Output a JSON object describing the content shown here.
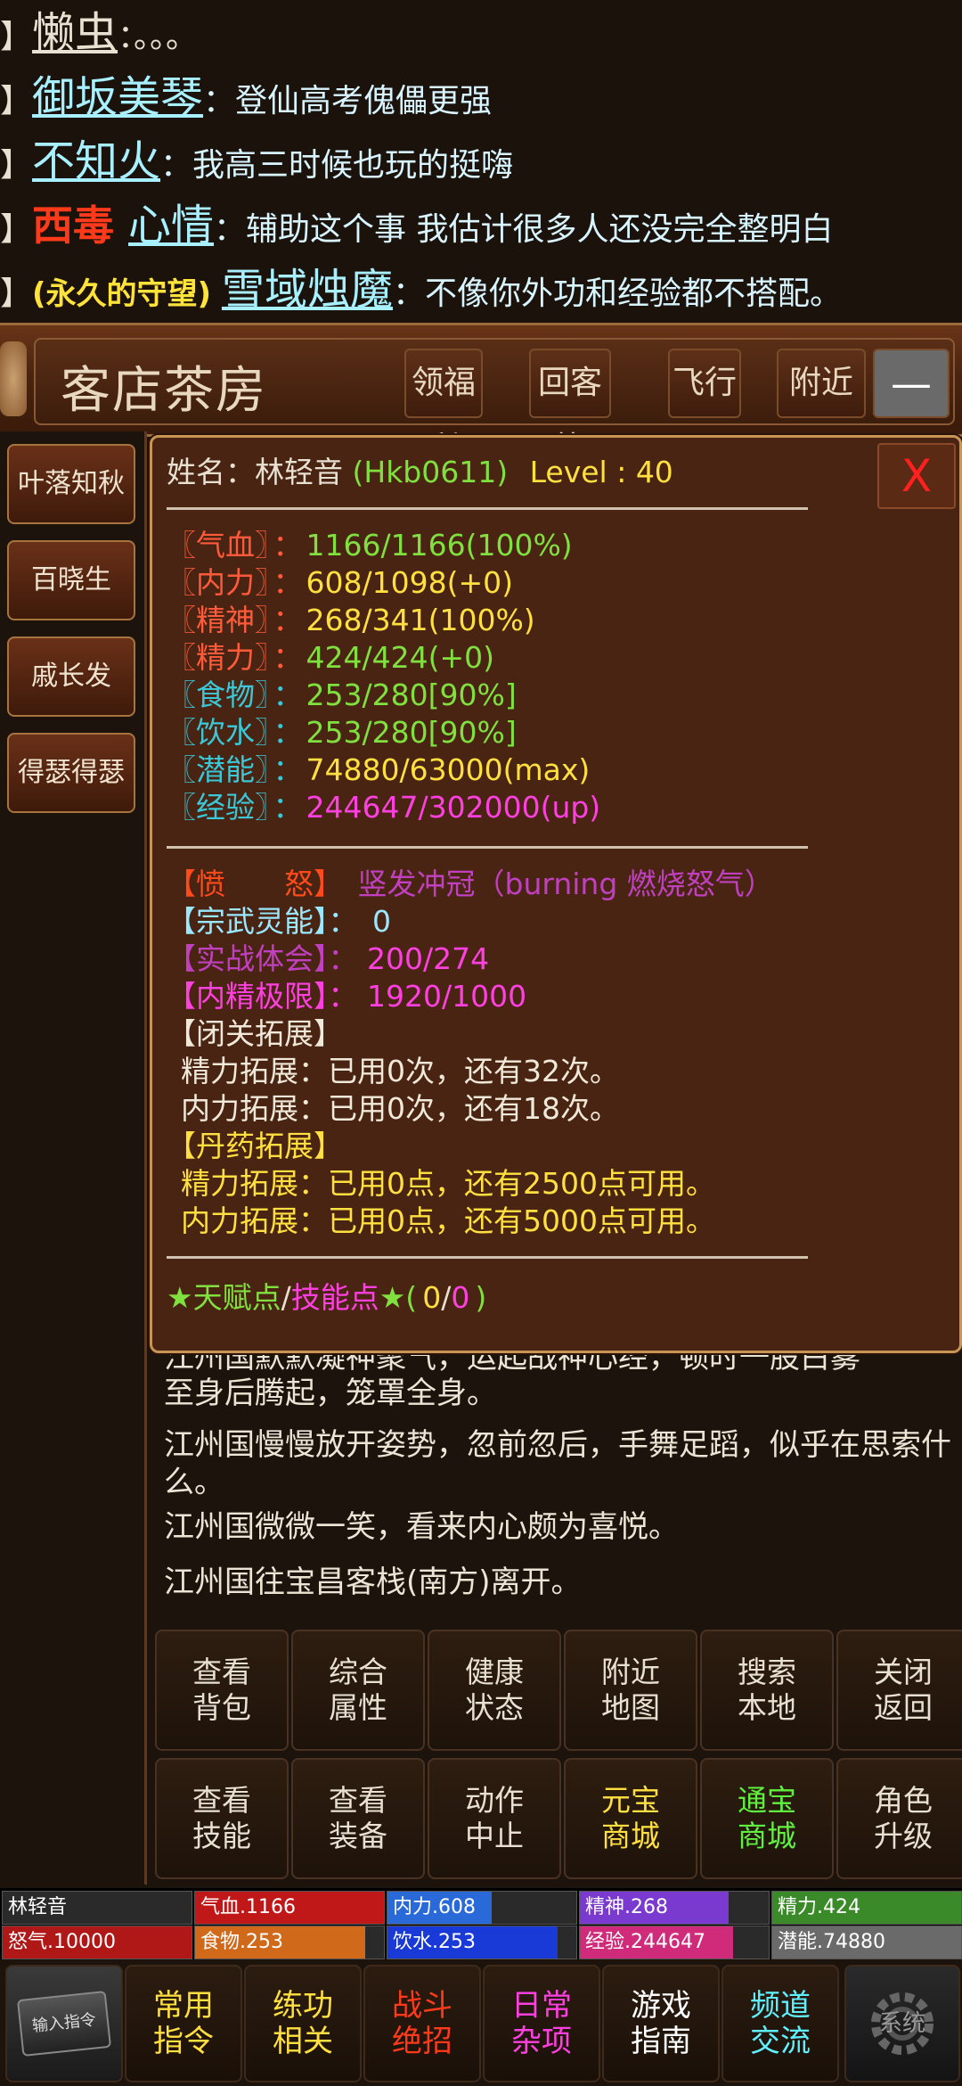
{
  "chat": [
    {
      "prefix": "】",
      "tag": "",
      "name": "懒虫",
      "message": "。。。",
      "name_color": "#e8e0d0"
    },
    {
      "prefix": "】",
      "tag": "",
      "name": "御坂美琴",
      "message": "登仙高考傀儡更强",
      "name_color": "#a8f0ff"
    },
    {
      "prefix": "】",
      "tag": "",
      "name": "不知火",
      "message": "我高三时候也玩的挺嗨",
      "name_color": "#a8f0ff"
    },
    {
      "prefix": "】",
      "tag": "西毒",
      "name": "心情",
      "message": "辅助这个事 我估计很多人还没完全整明白",
      "name_color": "#a8f0ff",
      "tag_color": "#ff3a1a"
    },
    {
      "prefix": "】",
      "tag": "(永久的守望)",
      "name": "雪域烛魔",
      "message": "不像你外功和经验都不搭配。",
      "name_color": "#a8f0ff",
      "tag_color": "#ffe23a"
    }
  ],
  "location": {
    "title": "客店茶房",
    "buttons": [
      "领福利",
      "回客栈",
      "飞行",
      "附近"
    ],
    "collapse": "—"
  },
  "npcs": [
    "叶落知秋",
    "百晓生",
    "戚长发",
    "得瑟得瑟"
  ],
  "character": {
    "name_label": "姓名：",
    "name": "林轻音",
    "id": "(Hkb0611)",
    "level": "Level : 40",
    "close": "X",
    "stats": [
      {
        "label": "〖气血〗",
        "value": "1166/1166(100%)",
        "label_color": "#ff5a3a",
        "value_color": "#80e040"
      },
      {
        "label": "〖内力〗",
        "value": "608/1098(+0)",
        "label_color": "#ff5a3a",
        "value_color": "#ffe040"
      },
      {
        "label": "〖精神〗",
        "value": "268/341(100%)",
        "label_color": "#ff5a3a",
        "value_color": "#ffe040"
      },
      {
        "label": "〖精力〗",
        "value": "424/424(+0)",
        "label_color": "#ff5a3a",
        "value_color": "#80e040"
      },
      {
        "label": "〖食物〗",
        "value": "253/280[90%]",
        "label_color": "#3ac8d8",
        "value_color": "#80e040"
      },
      {
        "label": "〖饮水〗",
        "value": "253/280[90%]",
        "label_color": "#3ac8d8",
        "value_color": "#80e040"
      },
      {
        "label": "〖潜能〗",
        "value": "74880/63000(max)",
        "label_color": "#3ac8d8",
        "value_color": "#ffe040"
      },
      {
        "label": "〖经验〗",
        "value": "244647/302000(up)",
        "label_color": "#3ac8d8",
        "value_color": "#ff40e0"
      }
    ],
    "colon": "：",
    "rage_label": "【愤　　怒】",
    "rage_value": "竖发冲冠（burning 燃烧怒气）",
    "sect_label": "【宗武灵能】：",
    "sect_value": "0",
    "combat_label": "【实战体会】：",
    "combat_value": "200/274",
    "essence_label": "【内精极限】：",
    "essence_value": "1920/1000",
    "closed_title": "【闭关拓展】",
    "closed_lines": [
      "精力拓展：已用0次，还有32次。",
      "内力拓展：已用0次，还有18次。"
    ],
    "pill_title": "【丹药拓展】",
    "pill_lines": [
      "精力拓展：已用0点，还有2500点可用。",
      "内力拓展：已用0点，还有5000点可用。"
    ],
    "talent_label": "★天赋点",
    "slash": "/",
    "skill_label": "技能点",
    "talent_star": "★(",
    "talent_value": "0",
    "slash2": "/",
    "skill_value": "0",
    "close_paren": ")",
    "separator": "————————————————————"
  },
  "log": [
    "江州国默默凝神聚气，运起战神心经，顿时一股白雾",
    "至身后腾起，笼罩全身。",
    "江州国慢慢放开姿势，忽前忽后，手舞足蹈，似乎在思索什么。",
    "江州国微微一笑，看来内心颇为喜悦。",
    "江州国往宝昌客栈(南方)离开。"
  ],
  "actions": [
    {
      "label": "查看背包",
      "color": "#e8e0d0"
    },
    {
      "label": "综合属性",
      "color": "#e8e0d0"
    },
    {
      "label": "健康状态",
      "color": "#e8e0d0"
    },
    {
      "label": "附近地图",
      "color": "#e8e0d0"
    },
    {
      "label": "搜索本地",
      "color": "#e8e0d0"
    },
    {
      "label": "关闭返回",
      "color": "#e8e0d0"
    },
    {
      "label": "查看技能",
      "color": "#e8e0d0"
    },
    {
      "label": "查看装备",
      "color": "#e8e0d0"
    },
    {
      "label": "动作中止",
      "color": "#e8e0d0"
    },
    {
      "label": "元宝商城",
      "color": "#ffe040"
    },
    {
      "label": "通宝商城",
      "color": "#60f040"
    },
    {
      "label": "角色升级",
      "color": "#e8e0d0"
    }
  ],
  "status_bars": [
    {
      "label": "林轻音",
      "fill": 0,
      "color": "#000000"
    },
    {
      "label": "气血.1166",
      "fill": 1.0,
      "color": "#c01818"
    },
    {
      "label": "内力.608",
      "fill": 0.55,
      "color": "#2a6ad8"
    },
    {
      "label": "精神.268",
      "fill": 0.79,
      "color": "#7a3ad0"
    },
    {
      "label": "精力.424",
      "fill": 1.0,
      "color": "#3a8a2a"
    },
    {
      "label": "怒气.10000",
      "fill": 1.0,
      "color": "#b01818"
    },
    {
      "label": "食物.253",
      "fill": 0.9,
      "color": "#d06a1a"
    },
    {
      "label": "饮水.253",
      "fill": 0.9,
      "color": "#1a3ad8"
    },
    {
      "label": "经验.244647",
      "fill": 0.81,
      "color": "#d02a7a"
    },
    {
      "label": "潜能.74880",
      "fill": 1.0,
      "color": "#6a6a6a"
    }
  ],
  "nav": [
    {
      "label": "常用指令",
      "color": "#ffe040"
    },
    {
      "label": "练功相关",
      "color": "#ffe040"
    },
    {
      "label": "战斗绝招",
      "color": "#ff3a1a"
    },
    {
      "label": "日常杂项",
      "color": "#ff40e0"
    },
    {
      "label": "游戏指南",
      "color": "#ffffff"
    },
    {
      "label": "频道交流",
      "color": "#60f0ff"
    }
  ],
  "input_label": "输入指令",
  "settings_label": "系统"
}
